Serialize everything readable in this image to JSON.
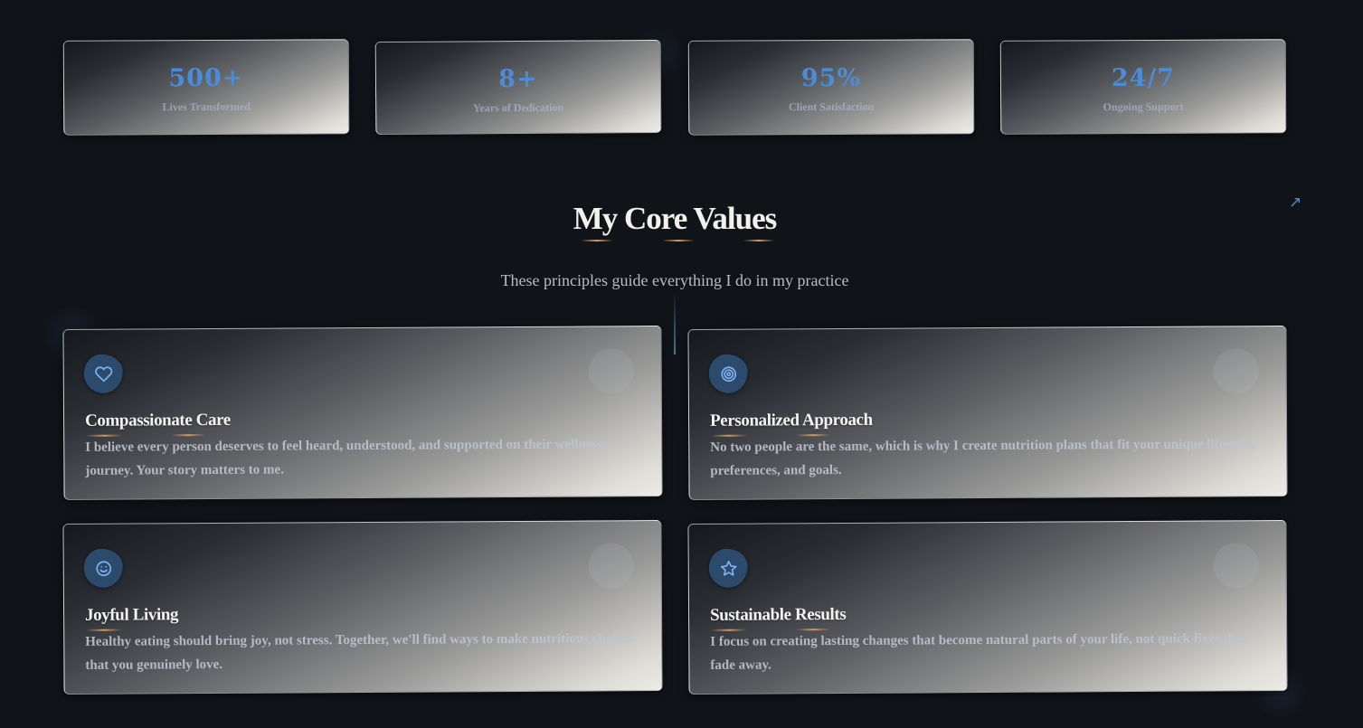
{
  "stats": [
    {
      "value": "500+",
      "label": "Lives Transformed"
    },
    {
      "value": "8+",
      "label": "Years of Dedication"
    },
    {
      "value": "95%",
      "label": "Client Satisfaction"
    },
    {
      "value": "24/7",
      "label": "Ongoing Support"
    }
  ],
  "core_values": {
    "heading": "My Core Values",
    "subheading": "These principles guide everything I do in my practice",
    "corner_icon": "↗",
    "cards": [
      {
        "icon": "heart-icon",
        "title": "Compassionate Care",
        "description": "I believe every person deserves to feel heard, understood, and supported on their wellness journey. Your story matters to me."
      },
      {
        "icon": "target-icon",
        "title": "Personalized Approach",
        "description": "No two people are the same, which is why I create nutrition plans that fit your unique lifestyle, preferences, and goals."
      },
      {
        "icon": "smile-icon",
        "title": "Joyful Living",
        "description": "Healthy eating should bring joy, not stress. Together, we'll find ways to make nutritious choices that you genuinely love."
      },
      {
        "icon": "star-icon",
        "title": "Sustainable Results",
        "description": "I focus on creating lasting changes that become natural parts of your life, not quick fixes that fade away."
      }
    ]
  },
  "colors": {
    "background": "#101318",
    "accent_blue": "#4d8bd6",
    "accent_gold": "#d69b5f"
  }
}
